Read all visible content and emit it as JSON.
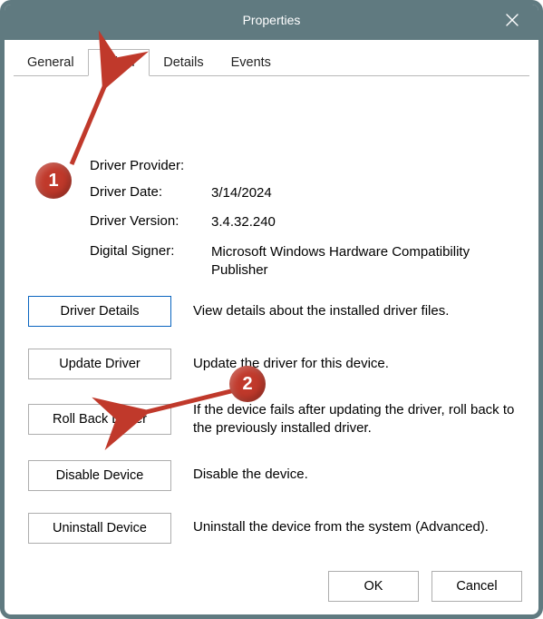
{
  "window": {
    "title": "Properties"
  },
  "tabs": {
    "general": "General",
    "driver": "Driver",
    "details": "Details",
    "events": "Events"
  },
  "info": {
    "provider_label": "Driver Provider:",
    "provider_value": "",
    "date_label": "Driver Date:",
    "date_value": "3/14/2024",
    "version_label": "Driver Version:",
    "version_value": "3.4.32.240",
    "signer_label": "Digital Signer:",
    "signer_value": "Microsoft Windows Hardware Compatibility Publisher"
  },
  "actions": {
    "details_btn": "Driver Details",
    "details_desc": "View details about the installed driver files.",
    "update_btn": "Update Driver",
    "update_desc": "Update the driver for this device.",
    "rollback_btn": "Roll Back Driver",
    "rollback_desc": "If the device fails after updating the driver, roll back to the previously installed driver.",
    "disable_btn": "Disable Device",
    "disable_desc": "Disable the device.",
    "uninstall_btn": "Uninstall Device",
    "uninstall_desc": "Uninstall the device from the system (Advanced)."
  },
  "footer": {
    "ok": "OK",
    "cancel": "Cancel"
  },
  "annotation": {
    "badge1": "1",
    "badge2": "2",
    "color": "#c0392b"
  }
}
